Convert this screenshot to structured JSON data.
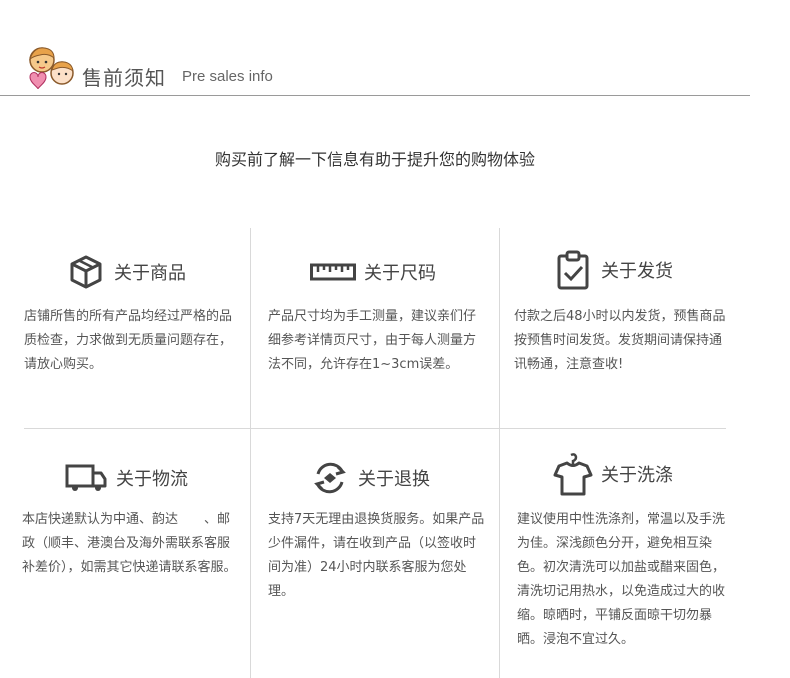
{
  "header": {
    "title_cn": "售前须知",
    "title_en": "Pre sales info"
  },
  "subtitle": "购买前了解一下信息有助于提升您的购物体验",
  "sections": [
    {
      "label": "关于商品",
      "icon": "box-icon",
      "text": "店铺所售的所有产品均经过严格的品质检查，力求做到无质量问题存在，请放心购买。"
    },
    {
      "label": "关于尺码",
      "icon": "ruler-icon",
      "text": "产品尺寸均为手工测量，建议亲们仔细参考详情页尺寸，由于每人测量方法不同，允许存在1~3cm误差。"
    },
    {
      "label": "关于发货",
      "icon": "clipboard-check-icon",
      "text": "付款之后48小时以内发货，预售商品按预售时间发货。发货期间请保持通讯畅通，注意查收!"
    },
    {
      "label": "关于物流",
      "icon": "truck-icon",
      "text": "本店快递默认为中通、韵达　　、邮政（顺丰、港澳台及海外需联系客服补差价），如需其它快递请联系客服。"
    },
    {
      "label": "关于退换",
      "icon": "exchange-icon",
      "text": "支持7天无理由退换货服务。如果产品少件漏件，请在收到产品（以签收时间为准）24小时内联系客服为您处理。"
    },
    {
      "label": "关于洗涤",
      "icon": "shirt-hanger-icon",
      "text": "建议使用中性洗涤剂，常温以及手洗为佳。深浅颜色分开，避免相互染色。初次清洗可以加盐或醋来固色，清洗切记用热水，以免造成过大的收缩。晾晒时，平铺反面晾干切勿暴晒。浸泡不宜过久。"
    }
  ]
}
